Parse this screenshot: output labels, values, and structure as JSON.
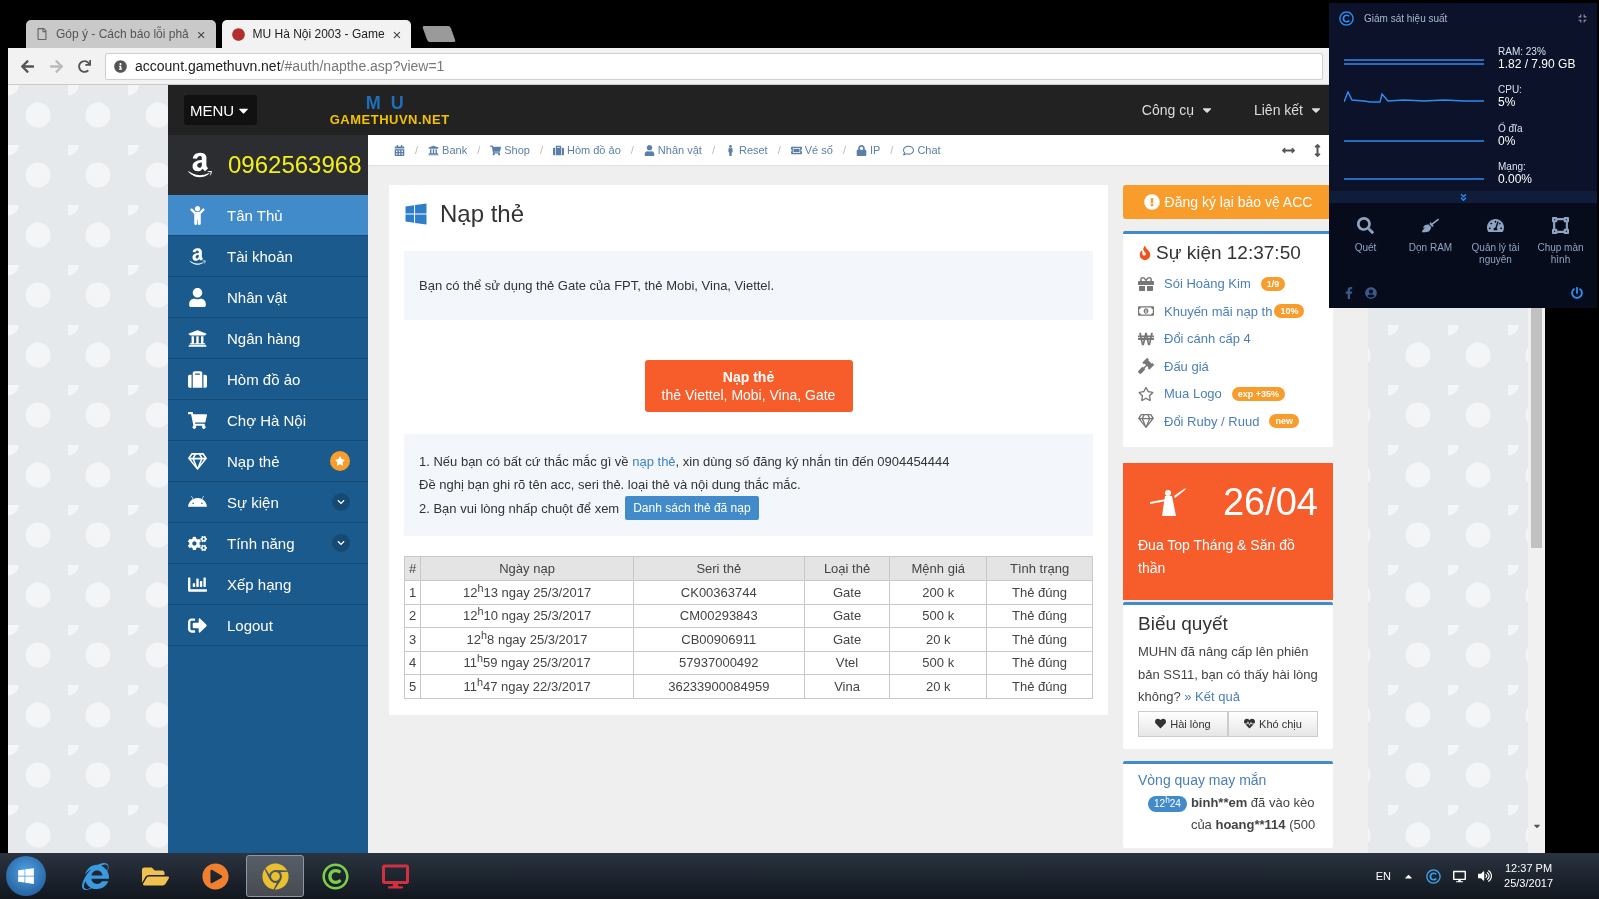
{
  "browser": {
    "tabs": [
      {
        "title": "Góp ý - Cách báo lỗi phả",
        "close": "×",
        "selected": false
      },
      {
        "title": "MU Hà Nội 2003 - Game",
        "close": "×",
        "selected": true
      }
    ],
    "address": {
      "host": "account.gamethuvn.net",
      "path": "/#auth/napthe.asp?view=1",
      "forward_enabled": false
    }
  },
  "navbar": {
    "menu_button": "MENU",
    "logo_mark": "MU",
    "logo_text": "GAMETHUVN.NET",
    "links": [
      {
        "label": "Công cụ"
      },
      {
        "label": "Liên kết"
      }
    ]
  },
  "sidebar": {
    "phone": "0962563968",
    "items": [
      {
        "label": "Tân Thủ",
        "kind": "plain",
        "selected": true
      },
      {
        "label": "Tài khoản",
        "kind": "plain",
        "selected": false
      },
      {
        "label": "Nhân vật",
        "kind": "plain",
        "selected": false
      },
      {
        "label": "Ngân hàng",
        "kind": "plain",
        "selected": false
      },
      {
        "label": "Hòm đồ ảo",
        "kind": "plain",
        "selected": false
      },
      {
        "label": "Chợ Hà Nội",
        "kind": "plain",
        "selected": false
      },
      {
        "label": "Nạp thẻ",
        "kind": "star",
        "selected": false
      },
      {
        "label": "Sự kiện",
        "kind": "submenu",
        "selected": false
      },
      {
        "label": "Tính năng",
        "kind": "submenu",
        "selected": false
      },
      {
        "label": "Xếp hạng",
        "kind": "plain",
        "selected": false
      },
      {
        "label": "Logout",
        "kind": "plain",
        "selected": false
      }
    ]
  },
  "breadcrumb": {
    "items": [
      {
        "sep": "/",
        "label": "Bank"
      },
      {
        "sep": "/",
        "label": "Shop"
      },
      {
        "sep": "/",
        "label": "Hòm đồ ảo"
      },
      {
        "sep": "/",
        "label": "Nhân vật"
      },
      {
        "sep": "/",
        "label": "Reset"
      },
      {
        "sep": "/",
        "label": "Vé số"
      },
      {
        "sep": "/",
        "label": "IP"
      },
      {
        "sep": "/",
        "label": "Chat"
      }
    ]
  },
  "content": {
    "title": "Nạp thẻ",
    "intro": "Bạn có thể sử dụng thẻ Gate của FPT, thẻ Mobi, Vina, Viettel.",
    "cta": {
      "title": "Nạp thẻ",
      "subtitle": "thẻ Viettel, Mobi, Vina, Gate"
    },
    "help": {
      "line1_before": "1. Nếu bạn có bất cứ thắc mắc gì về ",
      "line1_link": "nạp thẻ",
      "line1_after": ", xin dùng số đăng ký nhắn tin đến 0904454444",
      "line2": "Đề nghị bạn ghi rõ tên acc, seri thẻ. loại thẻ và nội dung thắc mắc.",
      "line3": "2. Bạn vui lòng nhấp chuột để xem",
      "list_button": "Danh sách thẻ đã nạp"
    },
    "table": {
      "columns": [
        "#",
        "Ngày nạp",
        "Seri thẻ",
        "Loại thẻ",
        "Mệnh giá",
        "Tình trạng"
      ],
      "rows": [
        [
          "1",
          "12$^{h}$13 ngay 25/3/2017",
          "CK00363744",
          "Gate",
          "200 k",
          "Thẻ đúng"
        ],
        [
          "2",
          "12$^{h}$10 ngay 25/3/2017",
          "CM00293843",
          "Gate",
          "500 k",
          "Thẻ đúng"
        ],
        [
          "3",
          "12$^{h}$8 ngay 25/3/2017",
          "CB00906911",
          "Gate",
          "20 k",
          "Thẻ đúng"
        ],
        [
          "4",
          "11$^{h}$59 ngay 25/3/2017",
          "57937000492",
          "Vtel",
          "500 k",
          "Thẻ đúng"
        ],
        [
          "5",
          "11$^{h}$47 ngay 22/3/2017",
          "36233900084959",
          "Vina",
          "20 k",
          "Thẻ đúng"
        ]
      ]
    }
  },
  "right": {
    "alert_button": "Đăng ký lại bảo vệ ACC",
    "events": {
      "title": "Sự kiện 12:37:50",
      "items": [
        {
          "label": "Sói Hoàng Kim",
          "badge": "1/9"
        },
        {
          "label": "Khuyến mãi nạp th",
          "badge": "10%"
        },
        {
          "label": "Đổi cánh cấp 4"
        },
        {
          "label": "Đấu giá"
        },
        {
          "label": "Mua Logo",
          "badge": "exp +35%"
        },
        {
          "label": "Đổi Ruby / Ruud",
          "badge": "new"
        }
      ]
    },
    "promo": {
      "date": "26/04",
      "text": "Đua Top Tháng & Săn đồ thần"
    },
    "poll": {
      "title": "Biểu quyết",
      "question": "MUHN đã nâng cấp lên phiên bản SS11, bạn có thấy hài lòng không?",
      "result_link": "» Kết quả",
      "options": [
        "Hài lòng",
        "Khó chịu"
      ]
    },
    "lucky": {
      "title": "Vòng quay may mắn",
      "time": "12$^{h}$24",
      "user": "binh**em",
      "mid": "đã vào kèo của",
      "target": "hoang**114",
      "tail": "(500"
    }
  },
  "monitor": {
    "title": "Giám sát hiệu suất",
    "metrics": [
      {
        "label": "RAM: 23%",
        "value": "1.82 / 7.90 GB"
      },
      {
        "label": "CPU:",
        "value": "5%"
      },
      {
        "label": "Ổ đĩa",
        "value": "0%"
      },
      {
        "label": "Mạng:",
        "value": "0.00%"
      }
    ],
    "actions": [
      "Quét",
      "Dọn RAM",
      "Quản lý tài nguyên",
      "Chụp màn hình"
    ]
  },
  "taskbar": {
    "apps": [
      {
        "selected": false
      },
      {
        "selected": false
      },
      {
        "selected": false
      },
      {
        "selected": true
      },
      {
        "selected": false
      },
      {
        "selected": false
      }
    ],
    "language": "EN",
    "time": "12:37 PM",
    "date": "25/3/2017"
  }
}
